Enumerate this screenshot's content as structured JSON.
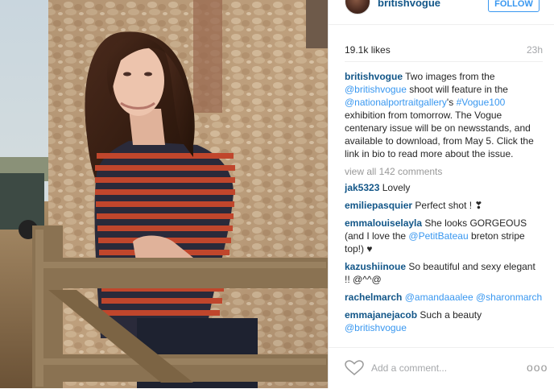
{
  "post": {
    "username": "britishvogue",
    "follow_label": "FOLLOW",
    "likes": "19.1k likes",
    "time": "23h"
  },
  "caption": {
    "user": "britishvogue",
    "text1": "Two images from the",
    "mention1": "@britishvogue",
    "text2": "shoot will feature in the",
    "mention2": "@nationalportraitgallery",
    "text3": "'s",
    "hashtag": "#Vogue100",
    "text4": "exhibition from tomorrow. The Vogue centenary issue will be on newsstands, and available to download, from May 5. Click the link in bio to read more about the issue."
  },
  "view_all": "view all 142 comments",
  "comments": [
    {
      "user": "jak5323",
      "text": "Lovely"
    },
    {
      "user": "emiliepasquier",
      "text": "Perfect shot ! ❣"
    },
    {
      "user": "emmalouiselayla",
      "text": "She looks GORGEOUS (and I love the",
      "mention": "@PetitBateau",
      "text_after": "breton stripe top!) ♥"
    },
    {
      "user": "kazushiinoue",
      "text": "So beautiful and sexy elegant !! @^^@"
    },
    {
      "user": "rachelmarch",
      "mention": "@amandaaalee",
      "mention2": "@sharonmarch"
    },
    {
      "user": "emmajanejacob",
      "text": "Such a beauty",
      "mention": "@britishvogue"
    }
  ],
  "footer": {
    "add_comment": "Add a comment...",
    "more": "ooo"
  }
}
